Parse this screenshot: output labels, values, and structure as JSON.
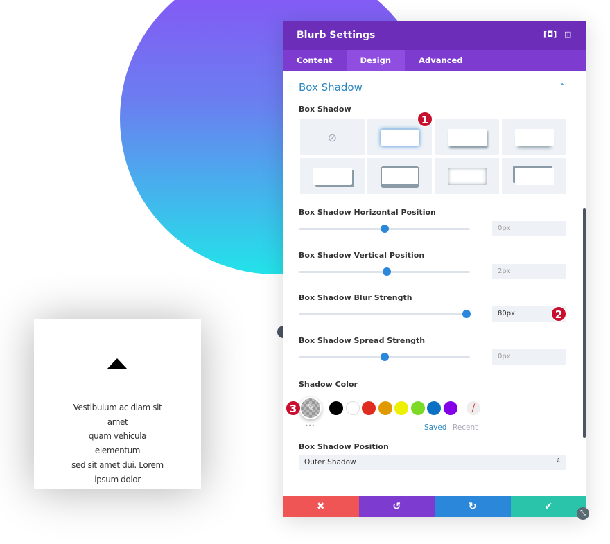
{
  "card": {
    "lines": [
      "Vestibulum ac diam sit amet",
      "quam vehicula elementum",
      "sed sit amet dui. Lorem",
      "ipsum dolor"
    ]
  },
  "panel": {
    "title": "Blurb Settings",
    "tabs": [
      "Content",
      "Design",
      "Advanced"
    ],
    "active_tab": "Design",
    "section_title": "Box Shadow",
    "box_shadow_label": "Box Shadow",
    "sliders": [
      {
        "label": "Box Shadow Horizontal Position",
        "value": "0px",
        "fraction": 0.5
      },
      {
        "label": "Box Shadow Vertical Position",
        "value": "2px",
        "fraction": 0.515
      },
      {
        "label": "Box Shadow Blur Strength",
        "value": "80px",
        "fraction": 0.98
      },
      {
        "label": "Box Shadow Spread Strength",
        "value": "0px",
        "fraction": 0.5
      }
    ],
    "shadow_color_label": "Shadow Color",
    "swatches": [
      "#000000",
      "#ffffff",
      "#e02b20",
      "#e09900",
      "#edf000",
      "#7cda24",
      "#0c71c3",
      "#8300e9"
    ],
    "saved": "Saved",
    "recent": "Recent",
    "more": "•••",
    "position_label": "Box Shadow Position",
    "position_value": "Outer Shadow",
    "badges": [
      "1",
      "2",
      "3"
    ],
    "footer_colors": [
      "#ef5555",
      "#7e3bd0",
      "#2b87da",
      "#29c4a9"
    ]
  }
}
